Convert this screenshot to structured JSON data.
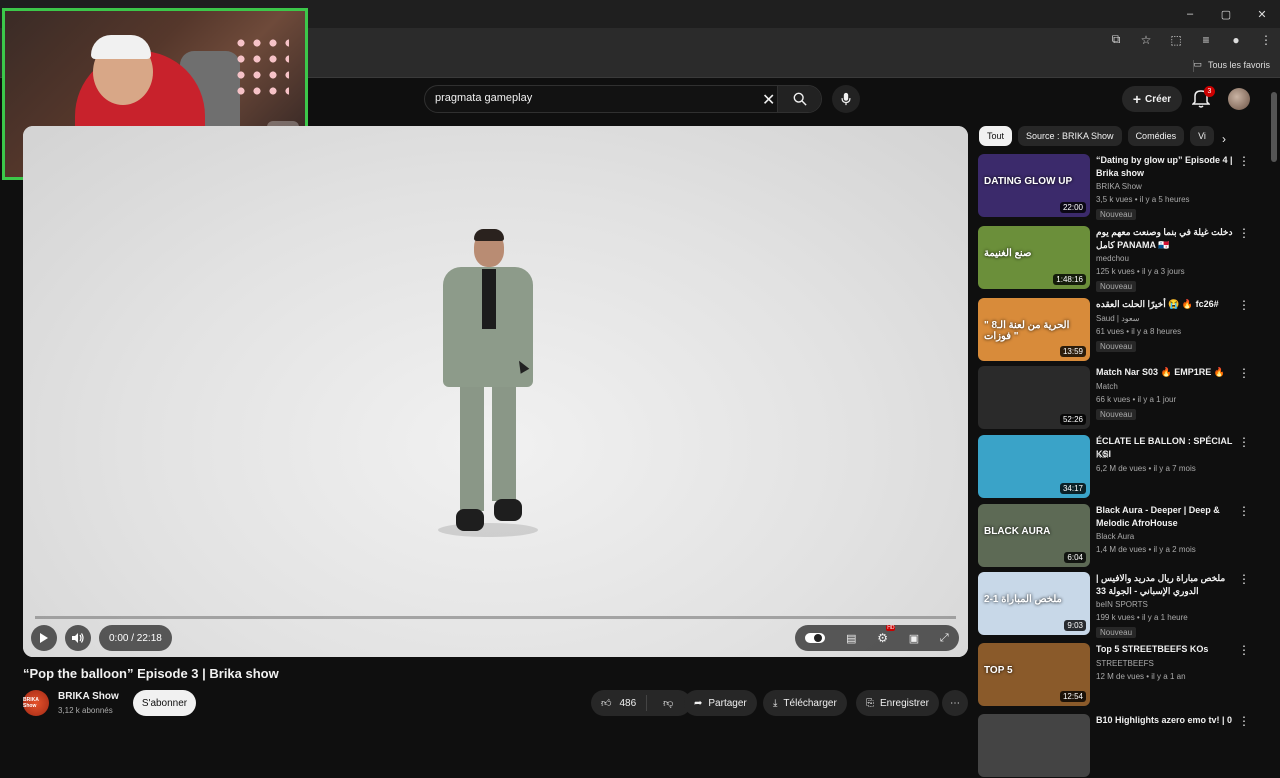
{
  "browser": {
    "window_controls": [
      "–",
      "▢",
      "✕"
    ],
    "bookmarks_label": "Tous les favoris"
  },
  "header": {
    "search_value": "pragmata gameplay",
    "create_label": "Créer",
    "notif_count": "3"
  },
  "player": {
    "time": "0:00 / 22:18",
    "progress": 0
  },
  "video": {
    "title": "“Pop the balloon” Episode 3 | Brika show",
    "channel": "BRIKA Show",
    "channel_avatar_text": "BRIKA Show",
    "subscribers": "3,12 k abonnés",
    "subscribe_label": "S'abonner",
    "likes": "486",
    "share_label": "Partager",
    "download_label": "Télécharger",
    "save_label": "Enregistrer"
  },
  "chips": [
    "Tout",
    "Source : BRIKA Show",
    "Comédies",
    "Vi"
  ],
  "recommendations": [
    {
      "title": "“Dating by glow up” Episode 4 | Brika show",
      "channel": "BRIKA Show",
      "meta": "3,5 k vues • il y a 5 heures",
      "badge": "Nouveau",
      "duration": "22:00",
      "color": "#3b2a6b",
      "overlay": "DATING GLOW UP"
    },
    {
      "title": "دخلت غيلة في بنما وصنعت معهم يوم كامل PANAMA 🇵🇦",
      "channel": "medchou",
      "meta": "125 k vues • il y a 3 jours",
      "badge": "Nouveau",
      "duration": "1:48:16",
      "color": "#6b8f3a",
      "overlay": "صنع الغنيمة"
    },
    {
      "title": "أخيرًا الحلت العقده 😭 🔥 fc26#",
      "channel": "Saud | سعود",
      "meta": "61 vues • il y a 8 heures",
      "badge": "Nouveau",
      "duration": "13:59",
      "color": "#d88b3a",
      "overlay": "\" الحرية من لعنة الـ8 فوزات \""
    },
    {
      "title": "Match Nar S03 🔥 EMP1RE 🔥",
      "channel": "Match",
      "meta": "66 k vues • il y a 1 jour",
      "badge": "Nouveau",
      "duration": "52:26",
      "color": "#2a2a2a",
      "overlay": ""
    },
    {
      "title": "ÉCLATE LE BALLON : SPÉCIAL KSI",
      "channel": "KSI",
      "meta": "6,2 M de vues • il y a 7 mois",
      "badge": "",
      "duration": "34:17",
      "color": "#3aa3c8",
      "overlay": ""
    },
    {
      "title": "Black Aura - Deeper | Deep & Melodic AfroHouse",
      "channel": "Black Aura",
      "meta": "1,4 M de vues • il y a 2 mois",
      "badge": "",
      "duration": "6:04",
      "color": "#5d6a55",
      "overlay": "BLACK AURA"
    },
    {
      "title": "ملخص مباراة ريال مدريد والافيس | الدوري الإسباني - الجولة 33",
      "channel": "beIN SPORTS",
      "meta": "199 k vues • il y a 1 heure",
      "badge": "Nouveau",
      "duration": "9:03",
      "color": "#c8d8e8",
      "overlay": "ملخص المباراة 1-2"
    },
    {
      "title": "Top 5 STREETBEEFS KOs",
      "channel": "STREETBEEFS",
      "meta": "12 M de vues • il y a 1 an",
      "badge": "",
      "duration": "12:54",
      "color": "#8a5a2a",
      "overlay": "TOP 5"
    },
    {
      "title": "B10 Highlights azero emo tv! | 0",
      "channel": "",
      "meta": "",
      "badge": "",
      "duration": "",
      "color": "#444",
      "overlay": ""
    }
  ],
  "colors": {
    "accent": "#3cc84a",
    "brand_red": "#cc0000"
  }
}
